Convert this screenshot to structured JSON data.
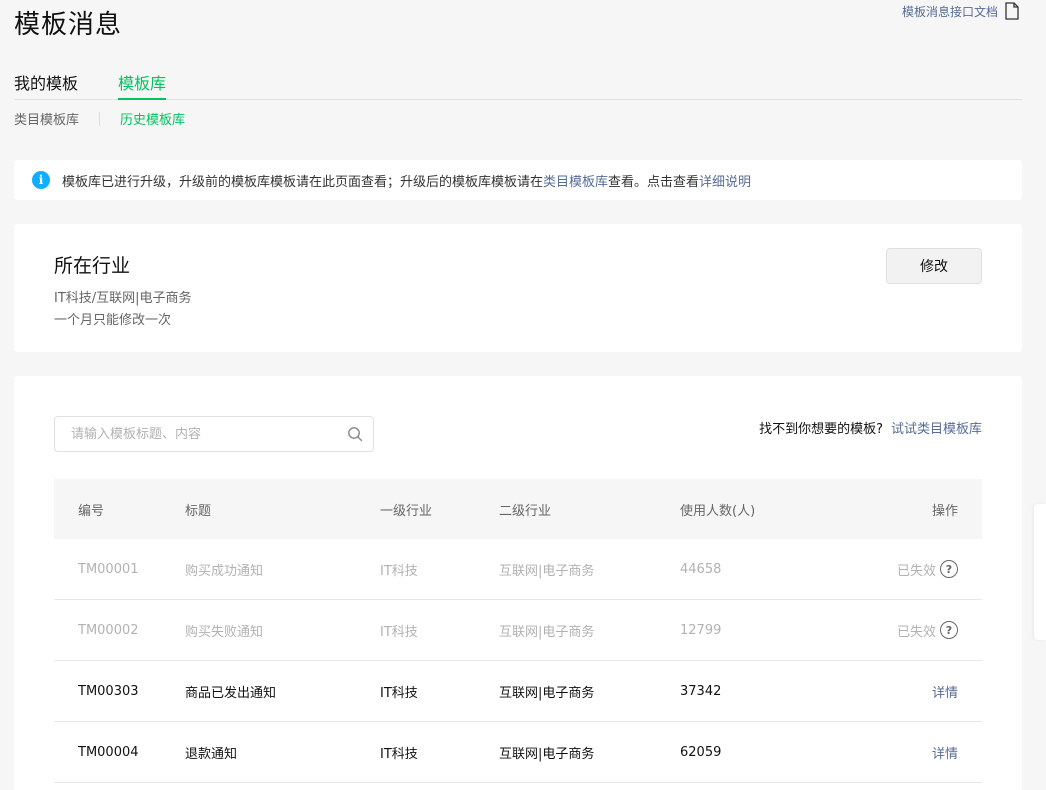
{
  "page": {
    "title": "模板消息",
    "doc_link": "模板消息接口文档",
    "doc_icon": "document-icon"
  },
  "tabs": [
    {
      "label": "我的模板",
      "active": false
    },
    {
      "label": "模板库",
      "active": true
    }
  ],
  "subtabs": [
    {
      "label": "类目模板库",
      "active": false
    },
    {
      "label": "历史模板库",
      "active": true
    }
  ],
  "notice": {
    "icon": "info-icon",
    "text_before": "模板库已进行升级，升级前的模板库模板请在此页面查看；升级后的模板库模板请在",
    "link1": "类目模板库",
    "text_middle": "查看。点击查看",
    "link2": "详细说明"
  },
  "industry": {
    "heading": "所在行业",
    "value": "IT科技/互联网|电子商务",
    "hint": "一个月只能修改一次",
    "modify_label": "修改"
  },
  "search": {
    "placeholder": "请输入模板标题、内容",
    "value": "",
    "icon": "search-icon"
  },
  "cant_find": {
    "text": "找不到你想要的模板?",
    "link": "试试类目模板库"
  },
  "table": {
    "headers": [
      "编号",
      "标题",
      "一级行业",
      "二级行业",
      "使用人数(人)",
      "操作"
    ],
    "rows": [
      {
        "id": "TM00001",
        "title": "购买成功通知",
        "level1": "IT科技",
        "level2": "互联网|电子商务",
        "users": "44658",
        "action": "已失效",
        "status": "disabled"
      },
      {
        "id": "TM00002",
        "title": "购买失败通知",
        "level1": "IT科技",
        "level2": "互联网|电子商务",
        "users": "12799",
        "action": "已失效",
        "status": "disabled"
      },
      {
        "id": "TM00303",
        "title": "商品已发出通知",
        "level1": "IT科技",
        "level2": "互联网|电子商务",
        "users": "37342",
        "action": "详情",
        "status": "active"
      },
      {
        "id": "TM00004",
        "title": "退款通知",
        "level1": "IT科技",
        "level2": "互联网|电子商务",
        "users": "62059",
        "action": "详情",
        "status": "active"
      }
    ]
  },
  "colors": {
    "accent": "#07c160",
    "link": "#576b95",
    "info": "#10aeff",
    "disabled_text": "#b2b2b2"
  }
}
